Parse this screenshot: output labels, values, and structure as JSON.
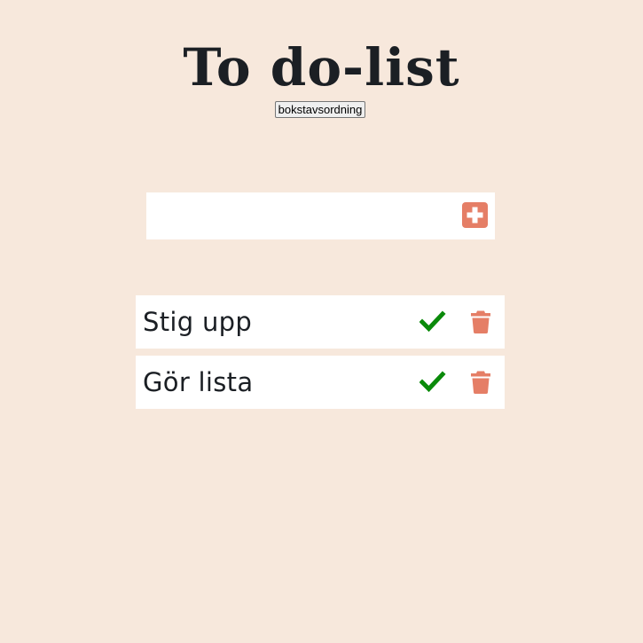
{
  "header": {
    "title": "To do-list",
    "sort_label": "bokstavsordning"
  },
  "add": {
    "input_value": "",
    "input_placeholder": "",
    "button_icon": "plus-square-icon"
  },
  "todos": [
    {
      "text": "Stig upp",
      "complete_icon": "check-icon",
      "delete_icon": "trash-icon"
    },
    {
      "text": "Gör lista",
      "complete_icon": "check-icon",
      "delete_icon": "trash-icon"
    }
  ],
  "colors": {
    "background": "#f7e8dc",
    "accent": "#e57e66",
    "check": "#0a8a0a",
    "text": "#1b1f24"
  }
}
